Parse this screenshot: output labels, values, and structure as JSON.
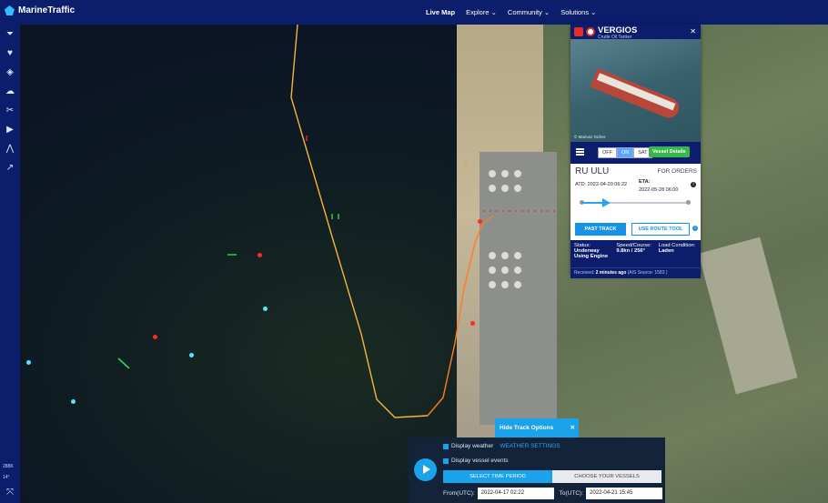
{
  "brand": {
    "name": "MarineTraffic"
  },
  "nav": {
    "live_map": "Live Map",
    "explore": "Explore",
    "community": "Community",
    "solutions": "Solutions"
  },
  "sidebar": {
    "icons": [
      "filter-icon",
      "heart-icon",
      "layers-icon",
      "weather-icon",
      "measure-icon",
      "play-icon",
      "route-icon",
      "analytics-icon"
    ],
    "vessel_count": "288K",
    "temp": "14°"
  },
  "vessel": {
    "name": "VERGIOS",
    "type": "Crude Oil Tanker",
    "photo_credit": "© Mariusz Sicher",
    "toggle_off": "OFF",
    "toggle_on": "ON",
    "toggle_sat": "SAT",
    "details_btn": "Vessel Details",
    "departure": "RU ULU",
    "destination": "FOR ORDERS",
    "atd": "ATD: 2022-04-20 06:22",
    "eta_label": "ETA:",
    "eta": "2022-05-28 06:00",
    "voyage_progress": 0.23,
    "past_track": "PAST TRACK",
    "route_tool": "USE ROUTE TOOL",
    "status_label": "Status:",
    "status_value": "Underway Using Engine",
    "speed_label": "Speed/Course:",
    "speed_value": "9.8kn / 256°",
    "load_label": "Load Condition:",
    "load_value": "Laden",
    "received": "Received:",
    "received_value": "2 minutes ago",
    "ais_source": "(AIS Source: 1583 )"
  },
  "track": {
    "hide_label": "Hide Track Options",
    "display_weather": "Display weather",
    "weather_settings": "WEATHER SETTINGS",
    "display_events": "Display vessel events",
    "select_time": "SELECT TIME PERIOD",
    "choose_vessels": "CHOOSE YOUR VESSELS",
    "from_label": "From(UTC):",
    "from_value": "2022-04-17 02:22",
    "to_label": "To(UTC):",
    "to_value": "2022-04-21 15:45"
  }
}
